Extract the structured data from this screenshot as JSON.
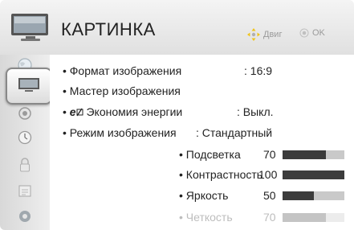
{
  "header": {
    "title": "КАРТИНКА",
    "hint_move": "Двиг",
    "hint_ok": "OK"
  },
  "sidebar": {
    "items": [
      {
        "icon": "globe-icon"
      },
      {
        "icon": "tv-picture-icon",
        "selected": true
      },
      {
        "icon": "speaker-icon"
      },
      {
        "icon": "clock-icon"
      },
      {
        "icon": "lock-icon"
      },
      {
        "icon": "calendar-icon"
      },
      {
        "icon": "gear-icon"
      }
    ]
  },
  "menu": {
    "aspect": {
      "label": "• Формат изображения",
      "value": ": 16:9"
    },
    "wizard": {
      "label": "• Мастер изображения"
    },
    "energy": {
      "prefix": "• ",
      "eco_glyph": "e",
      "label": " Экономия энергии",
      "value": ": Выкл."
    },
    "mode": {
      "label": "• Режим изображения",
      "value": ": Стандартный"
    },
    "settings": [
      {
        "label": "• Подсветка",
        "value": "70",
        "level": 0.7,
        "dim": false
      },
      {
        "label": "• Контрастность",
        "value": "100",
        "level": 1.0,
        "dim": false
      },
      {
        "label": "• Яркость",
        "value": "50",
        "level": 0.5,
        "dim": false
      },
      {
        "label": "• Четкость",
        "value": "70",
        "level": 0.7,
        "dim": true
      }
    ]
  },
  "colors": {
    "bar_fill": "#3c3c3c",
    "bar_track": "#c9c9c9"
  }
}
